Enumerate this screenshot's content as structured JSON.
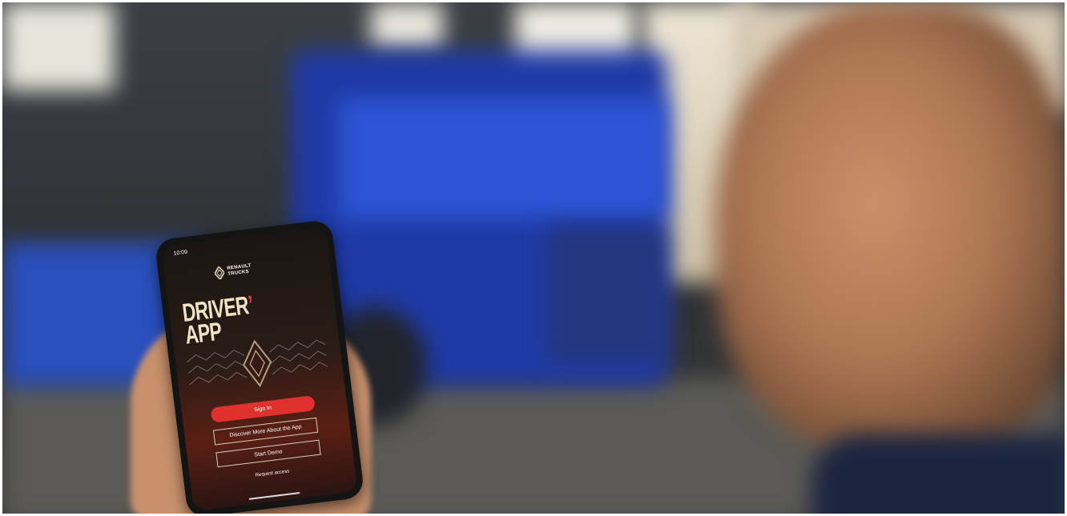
{
  "phone": {
    "status_time": "10:09",
    "brand": {
      "line1": "RENAULT",
      "line2": "TRUCKS"
    },
    "app_title": {
      "line1": "DRIVER",
      "apostrophe": "’",
      "line2": "APP"
    },
    "buttons": {
      "sign_in": "Sign In",
      "discover": "Discover More About the App",
      "start_demo": "Start Demo"
    },
    "request_access": "Request access"
  },
  "colors": {
    "accent_red": "#e0312f",
    "title_cream": "#f0e3c4",
    "truck_blue": "#2d55d6"
  }
}
